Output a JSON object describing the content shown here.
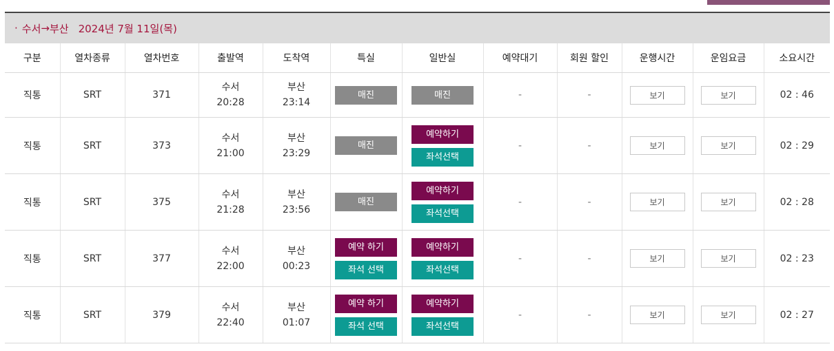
{
  "route": {
    "dot": "·",
    "origin": "수서",
    "arrow": "→",
    "destination": "부산",
    "date": "2024년 7월 11일(목)"
  },
  "columns": [
    "구분",
    "열차종류",
    "열차번호",
    "출발역",
    "도착역",
    "특실",
    "일반실",
    "예약대기",
    "회원 할인",
    "운행시간",
    "운임요금",
    "소요시간"
  ],
  "view_label": "보기",
  "trains": [
    {
      "type": "직통",
      "kind": "SRT",
      "no": "371",
      "dep_st": "수서",
      "dep_t": "20:28",
      "arr_st": "부산",
      "arr_t": "23:14",
      "special": [
        "매진"
      ],
      "general": [
        "매진"
      ],
      "wait": "-",
      "discount": "-",
      "duration": "02 : 46"
    },
    {
      "type": "직통",
      "kind": "SRT",
      "no": "373",
      "dep_st": "수서",
      "dep_t": "21:00",
      "arr_st": "부산",
      "arr_t": "23:29",
      "special": [
        "매진"
      ],
      "general": [
        "예약하기",
        "좌석선택"
      ],
      "wait": "-",
      "discount": "-",
      "duration": "02 : 29"
    },
    {
      "type": "직통",
      "kind": "SRT",
      "no": "375",
      "dep_st": "수서",
      "dep_t": "21:28",
      "arr_st": "부산",
      "arr_t": "23:56",
      "special": [
        "매진"
      ],
      "general": [
        "예약하기",
        "좌석선택"
      ],
      "wait": "-",
      "discount": "-",
      "duration": "02 : 28"
    },
    {
      "type": "직통",
      "kind": "SRT",
      "no": "377",
      "dep_st": "수서",
      "dep_t": "22:00",
      "arr_st": "부산",
      "arr_t": "00:23",
      "special": [
        "예약 하기",
        "좌석 선택"
      ],
      "general": [
        "예약하기",
        "좌석선택"
      ],
      "wait": "-",
      "discount": "-",
      "duration": "02 : 23"
    },
    {
      "type": "직통",
      "kind": "SRT",
      "no": "379",
      "dep_st": "수서",
      "dep_t": "22:40",
      "arr_st": "부산",
      "arr_t": "01:07",
      "special": [
        "예약 하기",
        "좌석 선택"
      ],
      "general": [
        "예약하기",
        "좌석선택"
      ],
      "wait": "-",
      "discount": "-",
      "duration": "02 : 27"
    }
  ],
  "colors": {
    "sold_out": "#8a8a8a",
    "reserve": "#7a0a4e",
    "seat_select": "#0d9b93",
    "route_text": "#a4143c"
  }
}
